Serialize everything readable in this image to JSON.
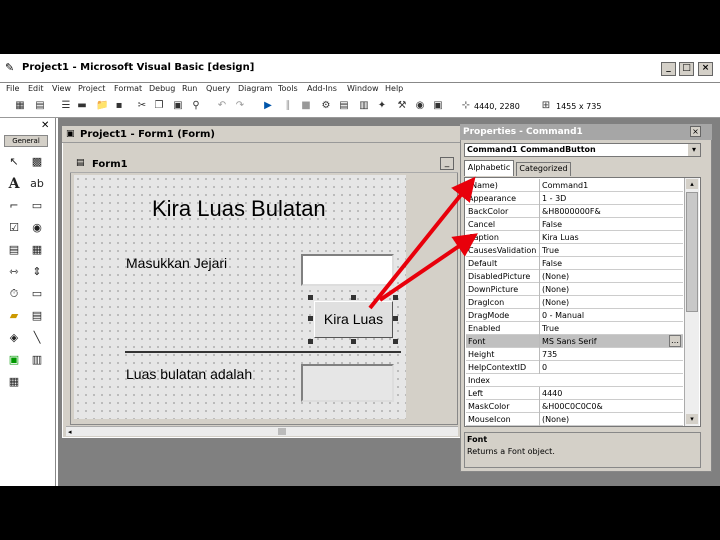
{
  "window": {
    "title": "Project1 - Microsoft Visual Basic [design]"
  },
  "menu": [
    "File",
    "Edit",
    "View",
    "Project",
    "Format",
    "Debug",
    "Run",
    "Query",
    "Diagram",
    "Tools",
    "Add-Ins",
    "Window",
    "Help"
  ],
  "toolbar": {
    "position": "4440, 2280",
    "size": "1455 x 735"
  },
  "toolbox": {
    "title": "General"
  },
  "project_window": {
    "title": "Project1 - Form1 (Form)"
  },
  "form": {
    "title": "Form1",
    "heading": "Kira Luas Bulatan",
    "label_input": "Masukkan Jejari",
    "button": "Kira Luas",
    "label_result": "Luas bulatan adalah"
  },
  "properties": {
    "title": "Properties - Command1",
    "object": "Command1 CommandButton",
    "tabs": [
      "Alphabetic",
      "Categorized"
    ],
    "rows": [
      {
        "name": "(Name)",
        "value": "Command1"
      },
      {
        "name": "Appearance",
        "value": "1 - 3D"
      },
      {
        "name": "BackColor",
        "value": "&H8000000F&"
      },
      {
        "name": "Cancel",
        "value": "False"
      },
      {
        "name": "Caption",
        "value": "Kira Luas"
      },
      {
        "name": "CausesValidation",
        "value": "True"
      },
      {
        "name": "Default",
        "value": "False"
      },
      {
        "name": "DisabledPicture",
        "value": "(None)"
      },
      {
        "name": "DownPicture",
        "value": "(None)"
      },
      {
        "name": "DragIcon",
        "value": "(None)"
      },
      {
        "name": "DragMode",
        "value": "0 - Manual"
      },
      {
        "name": "Enabled",
        "value": "True"
      },
      {
        "name": "Font",
        "value": "MS Sans Serif"
      },
      {
        "name": "Height",
        "value": "735"
      },
      {
        "name": "HelpContextID",
        "value": "0"
      },
      {
        "name": "Index",
        "value": ""
      },
      {
        "name": "Left",
        "value": "4440"
      },
      {
        "name": "MaskColor",
        "value": "&H00C0C0C0&"
      },
      {
        "name": "MouseIcon",
        "value": "(None)"
      }
    ],
    "desc_title": "Font",
    "desc_text": "Returns a Font object."
  },
  "colors": {
    "arrow": "#e8000b",
    "selected_row": "#c0c0c0"
  }
}
